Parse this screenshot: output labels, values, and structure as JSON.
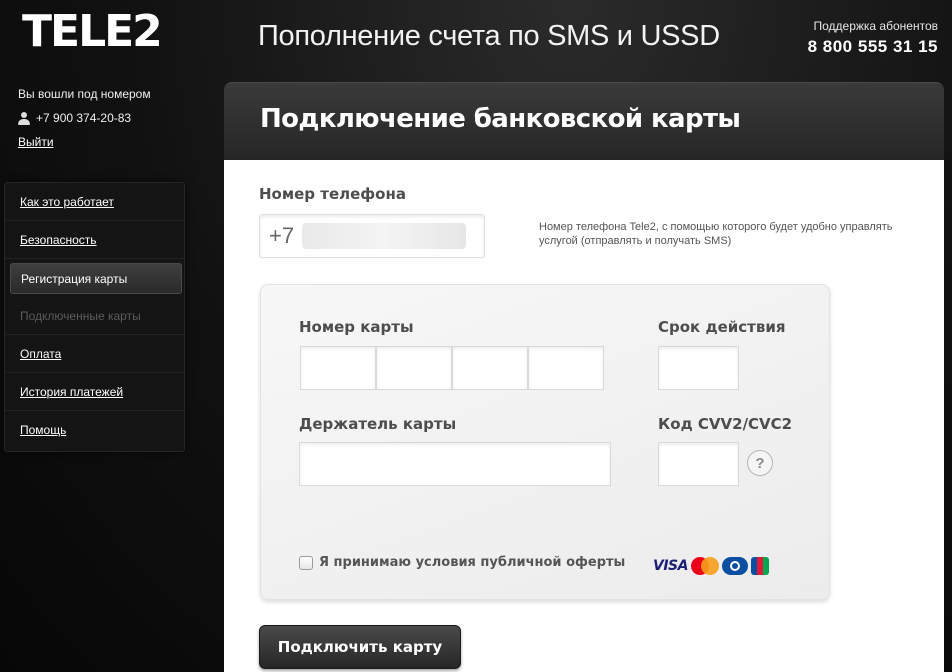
{
  "header": {
    "logo": "TELE2",
    "title": "Пополнение счета по SMS и USSD",
    "support_label": "Поддержка абонентов",
    "support_phone": "8 800 555 31 15"
  },
  "login": {
    "label": "Вы вошли под номером",
    "phone": "+7 900 374-20-83",
    "logout": "Выйти",
    "icon": "user-icon"
  },
  "menu": {
    "items": [
      {
        "label": "Как это работает",
        "state": "link"
      },
      {
        "label": "Безопасность",
        "state": "link"
      },
      {
        "label": "Регистрация карты",
        "state": "active"
      },
      {
        "label": "Подключенные карты",
        "state": "disabled"
      },
      {
        "label": "Оплата",
        "state": "link"
      },
      {
        "label": "История платежей",
        "state": "link"
      },
      {
        "label": "Помощь",
        "state": "link"
      }
    ]
  },
  "panel": {
    "title": "Подключение банковской карты",
    "phone_label": "Номер телефона",
    "phone_prefix": "+7",
    "phone_hint": "Номер телефона Tele2, с помощью которого будет удобно управлять услугой (отправлять и получать SMS)",
    "card": {
      "number_label": "Номер карты",
      "expiry_label": "Срок действия",
      "holder_label": "Держатель карты",
      "cvv_label": "Код CVV2/CVC2",
      "help_glyph": "?",
      "terms_text": "Я принимаю условия публичной оферты",
      "terms_checked": false,
      "payment_logos": [
        "VISA",
        "MasterCard",
        "Diners Club",
        "JCB"
      ]
    },
    "submit_label": "Подключить карту"
  },
  "colors": {
    "background": "#0b0b0b",
    "panel_header": "#2f2f2f",
    "button": "#333333",
    "label": "#4d4d4d"
  }
}
